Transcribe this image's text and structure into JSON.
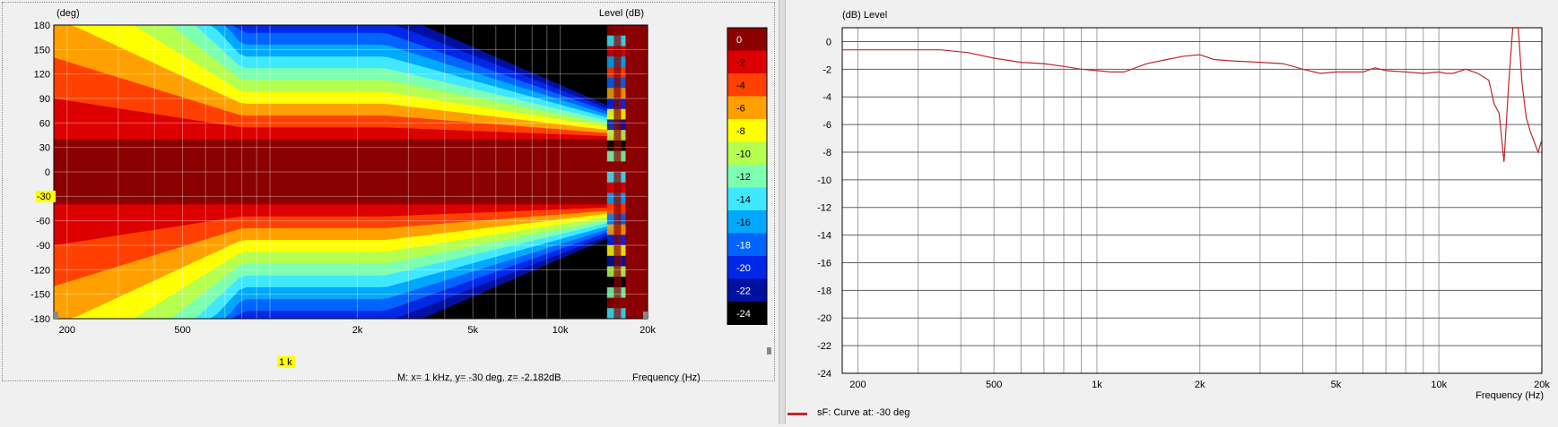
{
  "directivity_map": {
    "y_axis_label": "(deg)",
    "z_axis_label": "Level  (dB)",
    "x_axis_label": "Frequency  (Hz)",
    "y_ticks": [
      "180",
      "150",
      "120",
      "90",
      "60",
      "30",
      "0",
      "-30",
      "-60",
      "-90",
      "-120",
      "-150",
      "-180"
    ],
    "x_ticks": [
      "200",
      "500",
      "1k",
      "2k",
      "5k",
      "10k",
      "20k"
    ],
    "cursor_y_label": "-30",
    "cursor_x_label": "1 k",
    "marker_readout": "M:  x= 1 kHz,  y= -30 deg, z= -2.182dB",
    "colorbar": [
      {
        "label": "0",
        "color": "#8b0000"
      },
      {
        "label": "-2",
        "color": "#dc0000"
      },
      {
        "label": "-4",
        "color": "#ff4000"
      },
      {
        "label": "-6",
        "color": "#ffa000"
      },
      {
        "label": "-8",
        "color": "#ffff00"
      },
      {
        "label": "-10",
        "color": "#b4ff50"
      },
      {
        "label": "-12",
        "color": "#7dffb0"
      },
      {
        "label": "-14",
        "color": "#40e8ff"
      },
      {
        "label": "-16",
        "color": "#00a8ff"
      },
      {
        "label": "-18",
        "color": "#0064ff"
      },
      {
        "label": "-20",
        "color": "#0028e6"
      },
      {
        "label": "-22",
        "color": "#0010a0"
      },
      {
        "label": "-24",
        "color": "#000000"
      }
    ]
  },
  "chart_data": {
    "type": "line",
    "title": "",
    "ylabel": "(dB)  Level",
    "xlabel": "Frequency  (Hz)",
    "x_scale": "log",
    "xlim": [
      180,
      20000
    ],
    "ylim": [
      -24,
      1
    ],
    "y_ticks": [
      "0",
      "-2",
      "-4",
      "-6",
      "-8",
      "-10",
      "-12",
      "-14",
      "-16",
      "-18",
      "-20",
      "-22",
      "-24"
    ],
    "x_ticks": [
      "200",
      "500",
      "1k",
      "2k",
      "5k",
      "10k",
      "20k"
    ],
    "grid": true,
    "legend": {
      "placement": "bottom-left",
      "label": "sF: Curve at: -30 deg",
      "color": "#c0282d"
    },
    "series": [
      {
        "name": "sF: Curve at: -30 deg",
        "color": "#c0282d",
        "x": [
          180,
          250,
          350,
          420,
          500,
          600,
          700,
          800,
          900,
          1000,
          1100,
          1200,
          1400,
          1600,
          1800,
          2000,
          2200,
          2500,
          3000,
          3500,
          4000,
          4500,
          5000,
          6000,
          6500,
          7000,
          8000,
          9000,
          10000,
          10500,
          11000,
          12000,
          13000,
          14000,
          14500,
          15000,
          15500,
          16000,
          16500,
          17000,
          17500,
          18000,
          18500,
          19500,
          20000
        ],
        "y": [
          -0.6,
          -0.6,
          -0.6,
          -0.8,
          -1.2,
          -1.5,
          -1.6,
          -1.8,
          -2.0,
          -2.1,
          -2.2,
          -2.2,
          -1.6,
          -1.3,
          -1.05,
          -0.95,
          -1.3,
          -1.4,
          -1.5,
          -1.6,
          -2.0,
          -2.3,
          -2.2,
          -2.2,
          -1.9,
          -2.1,
          -2.2,
          -2.3,
          -2.2,
          -2.3,
          -2.3,
          -2.0,
          -2.3,
          -2.8,
          -4.5,
          -5.2,
          -8.7,
          -3.0,
          1.5,
          1.5,
          -3.0,
          -5.5,
          -6.5,
          -8.0,
          -7.1
        ]
      }
    ]
  }
}
